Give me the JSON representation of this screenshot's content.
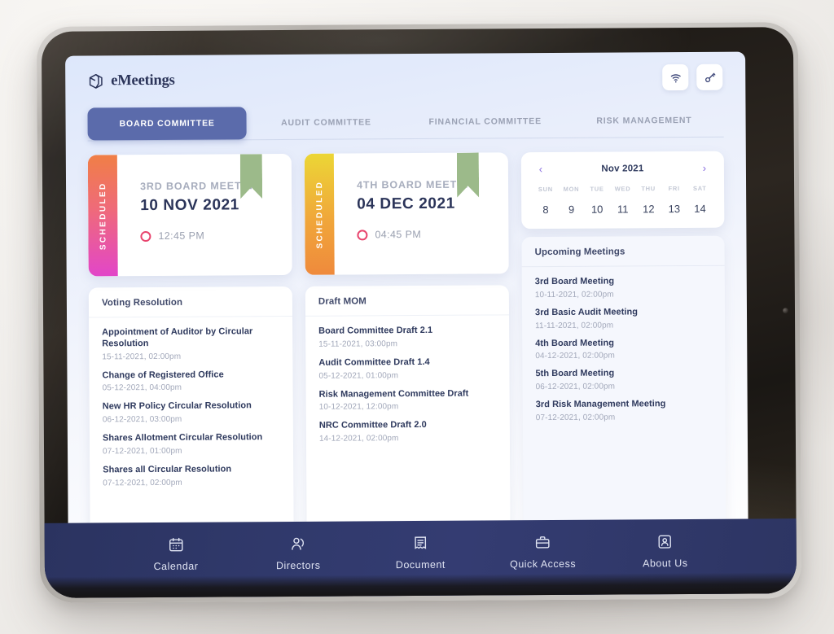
{
  "app": {
    "logo_text": "eMeetings",
    "logo_icon": "cube-icon"
  },
  "header": {
    "actions": [
      {
        "name": "wifi-icon",
        "label": "Wi-Fi"
      },
      {
        "name": "key-icon",
        "label": "Key"
      }
    ]
  },
  "tabs": [
    {
      "label": "BOARD COMMITTEE",
      "active": true
    },
    {
      "label": "AUDIT COMMITTEE",
      "active": false
    },
    {
      "label": "FINANCIAL COMMITTEE",
      "active": false
    },
    {
      "label": "RISK MANAGEMENT",
      "active": false
    }
  ],
  "meeting_cards": [
    {
      "status": "SCHEDULED",
      "title": "3RD BOARD MEETING",
      "date": "10 NOV 2021",
      "time": "12:45 PM",
      "strip_gradient": [
        "#f07f46",
        "#e246c9"
      ],
      "ribbon_color": "#9cba8a"
    },
    {
      "status": "SCHEDULED",
      "title": "4TH BOARD MEETING",
      "date": "04 DEC 2021",
      "time": "04:45 PM",
      "strip_gradient": [
        "#ecd636",
        "#ef8a3c"
      ],
      "ribbon_color": "#9cba8a"
    }
  ],
  "voting_resolution": {
    "title": "Voting Resolution",
    "items": [
      {
        "name": "Appointment of Auditor by Circular Resolution",
        "meta": "15-11-2021, 02:00pm"
      },
      {
        "name": "Change of Registered Office",
        "meta": "05-12-2021, 04:00pm"
      },
      {
        "name": "New HR Policy Circular Resolution",
        "meta": "06-12-2021, 03:00pm"
      },
      {
        "name": "Shares Allotment Circular Resolution",
        "meta": "07-12-2021, 01:00pm"
      },
      {
        "name": "Shares all Circular Resolution",
        "meta": "07-12-2021, 02:00pm"
      }
    ]
  },
  "draft_mom": {
    "title": "Draft MOM",
    "items": [
      {
        "name": "Board Committee Draft 2.1",
        "meta": "15-11-2021, 03:00pm"
      },
      {
        "name": "Audit Committee Draft 1.4",
        "meta": "05-12-2021, 01:00pm"
      },
      {
        "name": "Risk Management Committee Draft",
        "meta": "10-12-2021, 12:00pm"
      },
      {
        "name": "NRC Committee Draft 2.0",
        "meta": "14-12-2021, 02:00pm"
      }
    ]
  },
  "calendar": {
    "month": "Nov 2021",
    "prev_icon": "chevron-left-icon",
    "next_icon": "chevron-right-icon",
    "weekdays": [
      "SUN",
      "MON",
      "TUE",
      "WED",
      "THU",
      "FRI",
      "SAT"
    ],
    "days": [
      "8",
      "9",
      "10",
      "11",
      "12",
      "13",
      "14"
    ],
    "accent_color": "#8a6fe0"
  },
  "upcoming": {
    "title": "Upcoming Meetings",
    "items": [
      {
        "name": "3rd Board Meeting",
        "meta": "10-11-2021, 02:00pm"
      },
      {
        "name": "3rd Basic Audit Meeting",
        "meta": "11-11-2021, 02:00pm"
      },
      {
        "name": "4th Board Meeting",
        "meta": "04-12-2021, 02:00pm"
      },
      {
        "name": "5th Board Meeting",
        "meta": "06-12-2021, 02:00pm"
      },
      {
        "name": "3rd Risk Management Meeting",
        "meta": "07-12-2021, 02:00pm"
      }
    ]
  },
  "bottom_nav": [
    {
      "label": "Calendar",
      "icon": "calendar-icon"
    },
    {
      "label": "Directors",
      "icon": "users-icon"
    },
    {
      "label": "Document",
      "icon": "document-icon"
    },
    {
      "label": "Quick Access",
      "icon": "briefcase-icon"
    },
    {
      "label": "About Us",
      "icon": "person-card-icon"
    }
  ],
  "theme": {
    "active_tab_color": "#5b6bab",
    "nav_bar_color": "#30396b",
    "heading_color": "#2b3459",
    "clock_accent": "#e8456e"
  }
}
